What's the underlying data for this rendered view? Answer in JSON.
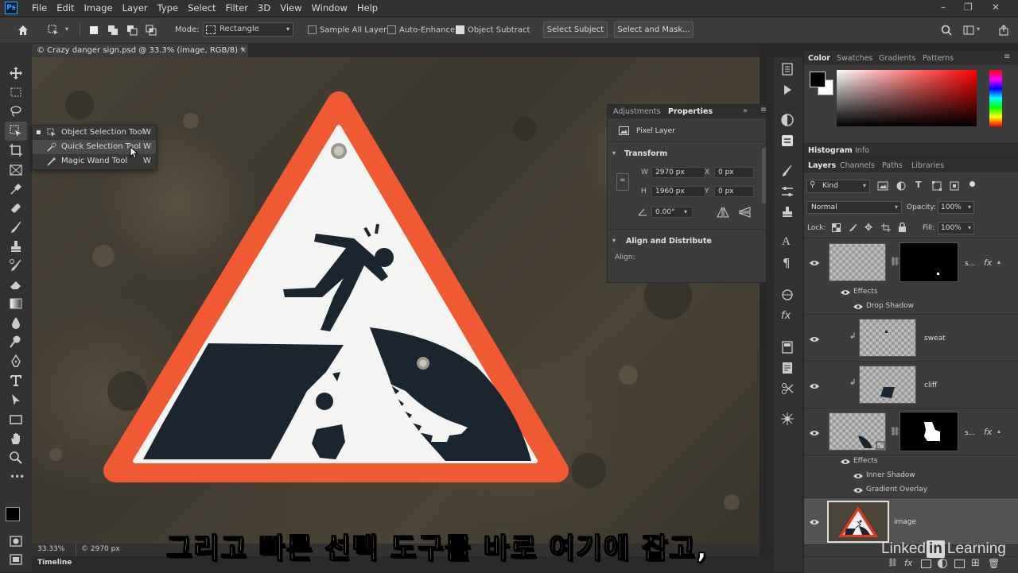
{
  "app": {
    "logo_text": "Ps",
    "menu": [
      "File",
      "Edit",
      "Image",
      "Layer",
      "Type",
      "Select",
      "Filter",
      "3D",
      "View",
      "Window",
      "Help"
    ],
    "window_controls": [
      "–",
      "❐",
      "✕"
    ]
  },
  "options_bar": {
    "mode_label": "Mode:",
    "mode_value": "Rectangle",
    "sample_all_layers": {
      "label": "Sample All Layers",
      "checked": false
    },
    "auto_enhance": {
      "label": "Auto-Enhance",
      "checked": false
    },
    "object_subtract": {
      "label": "Object Subtract",
      "checked": true
    },
    "select_subject_label": "Select Subject",
    "select_and_mask_label": "Select and Mask..."
  },
  "document": {
    "tab_title": "© Crazy danger sign.psd @ 33.3% (image, RGB/8) *",
    "tab_close": "×",
    "zoom": "33.33%",
    "doc_size": "© 2970 px"
  },
  "tool_flyout": {
    "items": [
      {
        "label": "Object Selection Tool",
        "shortcut": "W",
        "active": true
      },
      {
        "label": "Quick Selection Tool",
        "shortcut": "W",
        "active": false
      },
      {
        "label": "Magic Wand Tool",
        "shortcut": "W",
        "active": false
      }
    ]
  },
  "properties_panel": {
    "tabs": [
      "Adjustments",
      "Properties"
    ],
    "active_tab": "Properties",
    "kind_label": "Pixel Layer",
    "transform_label": "Transform",
    "w_label": "W",
    "w_value": "2970 px",
    "h_label": "H",
    "h_value": "1960 px",
    "x_label": "X",
    "x_value": "0 px",
    "y_label": "Y",
    "y_value": "0 px",
    "angle_value": "0.00°",
    "align_section": "Align and Distribute",
    "align_label": "Align:"
  },
  "color_panel": {
    "tabs": [
      "Color",
      "Swatches",
      "Gradients",
      "Patterns"
    ],
    "active_tab": "Color",
    "foreground": "#000000",
    "background": "#ffffff",
    "hue": "#ff0000"
  },
  "histogram_tabs": [
    "Histogram",
    "Info"
  ],
  "layers_panel": {
    "tabs": [
      "Layers",
      "Channels",
      "Paths",
      "Libraries"
    ],
    "active_tab": "Layers",
    "filter_label": "Kind",
    "blend_mode": "Normal",
    "opacity_label": "Opacity:",
    "opacity_value": "100%",
    "lock_label": "Lock:",
    "fill_label": "Fill:",
    "fill_value": "100%",
    "fx_symbol": "fx",
    "effects_label": "Effects",
    "layers": [
      {
        "name": "s...",
        "effects": [
          "Drop Shadow"
        ]
      },
      {
        "name": "sweat"
      },
      {
        "name": "cliff"
      },
      {
        "name": "s...",
        "effects": [
          "Inner Shadow",
          "Gradient Overlay"
        ]
      },
      {
        "name": "image"
      }
    ]
  },
  "bottom": {
    "timeline_label": "Timeline",
    "subtitle": "그리고 빠른 선택 도구를 바로 여기에 잡고,",
    "brand_left": "Linked",
    "brand_in": "in",
    "brand_right": "Learning"
  }
}
